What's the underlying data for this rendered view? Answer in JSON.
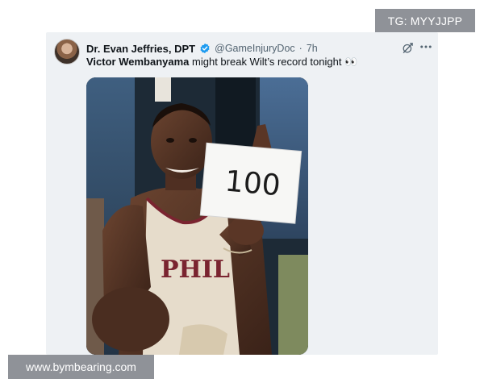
{
  "tweet": {
    "author_name": "Dr. Evan Jeffries, DPT",
    "author_handle": "@GameInjuryDoc",
    "separator": "·",
    "timestamp": "7h",
    "text_strong": "Victor Wembanyama",
    "text_rest": " might break Wilt’s record tonight 👀",
    "photo": {
      "sign_text": "100",
      "jersey_text": "PHIL"
    }
  },
  "watermarks": {
    "top_right": "TG: MYYJJPP",
    "bottom_left": "www.bymbearing.com"
  },
  "colors": {
    "verified_blue": "#1d9bf0",
    "muted_text": "#536471",
    "card_background": "#eef1f4",
    "watermark_gray": "#8f9298"
  },
  "icons": [
    "avatar",
    "verified-badge-icon",
    "grok-icon",
    "more-icon"
  ]
}
